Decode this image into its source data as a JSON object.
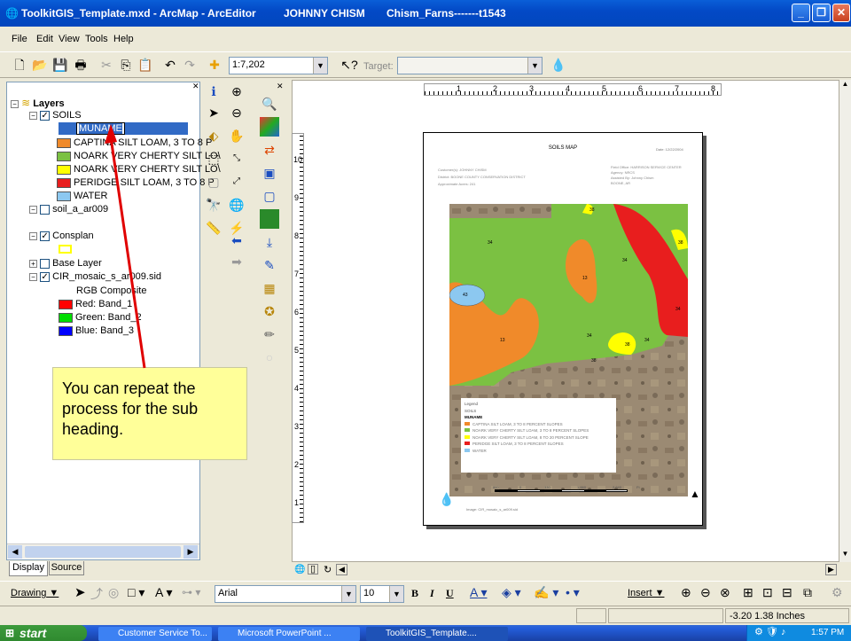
{
  "window": {
    "title": "ToolkitGIS_Template.mxd - ArcMap - ArcEditor",
    "user": "JOHNNY CHISM",
    "file": "Chism_Farns-------t1543"
  },
  "menu": [
    "File",
    "Edit",
    "View",
    "Tools",
    "Help"
  ],
  "toolbar": {
    "scale": "1:7,202",
    "target_label": "Target:"
  },
  "toc": {
    "root": "Layers",
    "soils_layer": "SOILS",
    "field_edit": "MUNAME",
    "legend_items": [
      {
        "label": "CAPTINA SILT LOAM, 3 TO 8 P",
        "color": "#f08a2a"
      },
      {
        "label": "NOARK VERY CHERTY SILT LO\\",
        "color": "#7bc142"
      },
      {
        "label": "NOARK VERY CHERTY SILT LO\\",
        "color": "#ffff00"
      },
      {
        "label": "PERIDGE SILT LOAM, 3 TO 8 P",
        "color": "#e81e1e"
      },
      {
        "label": "WATER",
        "color": "#8cc8f0"
      }
    ],
    "soil_layer2": "soil_a_ar009",
    "consplan": "Consplan",
    "base_layer": "Base Layer",
    "cir_layer": "CIR_mosaic_s_ar009.sid",
    "rgb": "RGB Composite",
    "bands": [
      {
        "label": "Red:   Band_1",
        "color": "#ff0000"
      },
      {
        "label": "Green: Band_2",
        "color": "#00dd00"
      },
      {
        "label": "Blue:  Band_3",
        "color": "#0000ff"
      }
    ],
    "tabs": [
      "Display",
      "Source"
    ]
  },
  "callout": "You can repeat the process for the sub heading.",
  "layout": {
    "map_title": "SOILS MAP",
    "date": "Date: 12/22/2004",
    "left_info": [
      "Customer(s): JOHNNY CHISM",
      "District: BOONE COUNTY CONSERVATION DISTRICT",
      "Approximate Acres: 241"
    ],
    "right_info": [
      "Field Office: HARRISON SERVICE CENTER",
      "Agency: NRCS",
      "Assisted By: Johnny Chism",
      "BOONE, AR"
    ],
    "legend_title": "Legend",
    "legend_sub": "SOILS",
    "legend_field": "MUNAME",
    "legend_entries": [
      {
        "label": "CAPTINA SILT LOAM, 3 TO 8 PERCENT SLOPES",
        "color": "#f08a2a"
      },
      {
        "label": "NOARK VERY CHERTY SILT LOAM, 3 TO 8 PERCENT SLOPES",
        "color": "#7bc142"
      },
      {
        "label": "NOARK VERY CHERTY SILT LOAM, 8 TO 20 PERCENT SLOPE",
        "color": "#ffff00"
      },
      {
        "label": "PERIDGE SILT LOAM, 3 TO 8 PERCENT SLOPES",
        "color": "#e81e1e"
      },
      {
        "label": "WATER",
        "color": "#8cc8f0"
      }
    ],
    "image_caption": "Image: CIR_mosaic_s_ar009.sid",
    "polygon_labels": [
      "34",
      "38",
      "38",
      "13",
      "43",
      "13",
      "34",
      "34",
      "38",
      "38",
      "34",
      "34"
    ],
    "scale_labels": [
      "860",
      "0",
      "330",
      "1,660",
      "2,640"
    ],
    "scale_unit": "Ft"
  },
  "ruler": {
    "h": [
      "1",
      "2",
      "3",
      "4",
      "5",
      "6",
      "7",
      "8"
    ],
    "v": [
      "10",
      "9",
      "8",
      "7",
      "6",
      "5",
      "4",
      "3",
      "2",
      "1"
    ]
  },
  "drawbar": {
    "drawing": "Drawing",
    "font": "Arial",
    "size": "10",
    "insert": "Insert"
  },
  "status": {
    "coords": "-3.20  1.38 Inches"
  },
  "taskbar": {
    "start": "start",
    "tasks": [
      "Customer Service To...",
      "Microsoft PowerPoint ...",
      "ToolkitGIS_Template...."
    ],
    "clock": "1:57 PM"
  }
}
